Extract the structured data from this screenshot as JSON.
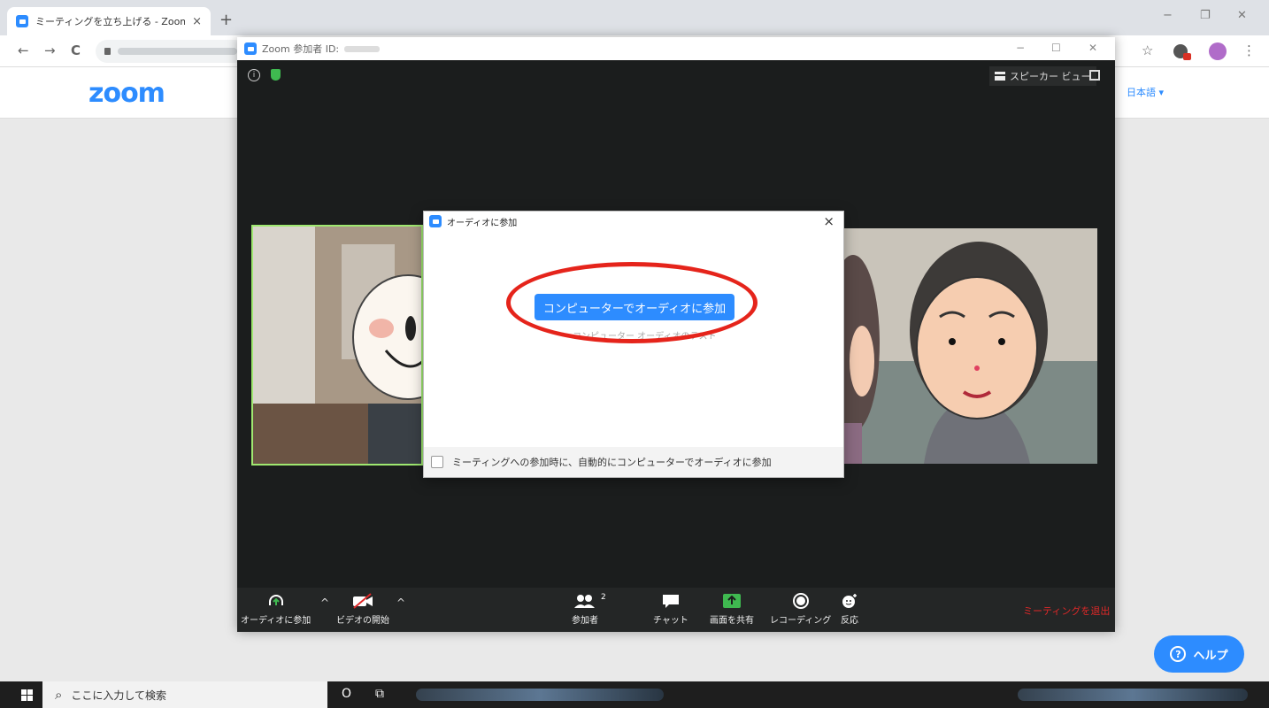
{
  "browser": {
    "tab_title": "ミーティングを立ち上げる - Zoom",
    "tab_close": "×",
    "new_tab": "+",
    "back": "←",
    "forward": "→",
    "reload": "C",
    "star": "☆",
    "menu": "⋮",
    "minimize": "−",
    "restore": "❐",
    "close": "✕"
  },
  "page": {
    "logo": "zoom",
    "language": "日本語 ▾",
    "help_icon": "?",
    "help": "ヘルプ"
  },
  "zoom_window": {
    "title": "Zoom 参加者 ID:",
    "minimize": "−",
    "maximize": "☐",
    "close": "✕",
    "info": "i",
    "speaker_view": "スピーカー ビュー",
    "leave": "ミーティングを退出",
    "participant_count": "2",
    "toolbar": {
      "join_audio": "オーディオに参加",
      "video": "ビデオの開始",
      "participants": "参加者",
      "chat": "チャット",
      "share": "画面を共有",
      "record": "レコーディング",
      "reactions": "反応",
      "caret": "^"
    }
  },
  "dialog": {
    "title": "オーディオに参加",
    "close": "×",
    "join_button": "コンピューターでオーディオに参加",
    "test_link": "コンピューター オーディオのテスト",
    "auto_join_label": "ミーティングへの参加時に、自動的にコンピューターでオーディオに参加"
  },
  "taskbar": {
    "search_icon": "⌕",
    "search_placeholder": "ここに入力して検索",
    "cortana": "O",
    "task_view": "⧉"
  },
  "colors": {
    "zoom_blue": "#2d8cff",
    "leave_red": "#e02828",
    "annotation_red": "#e5241b"
  }
}
